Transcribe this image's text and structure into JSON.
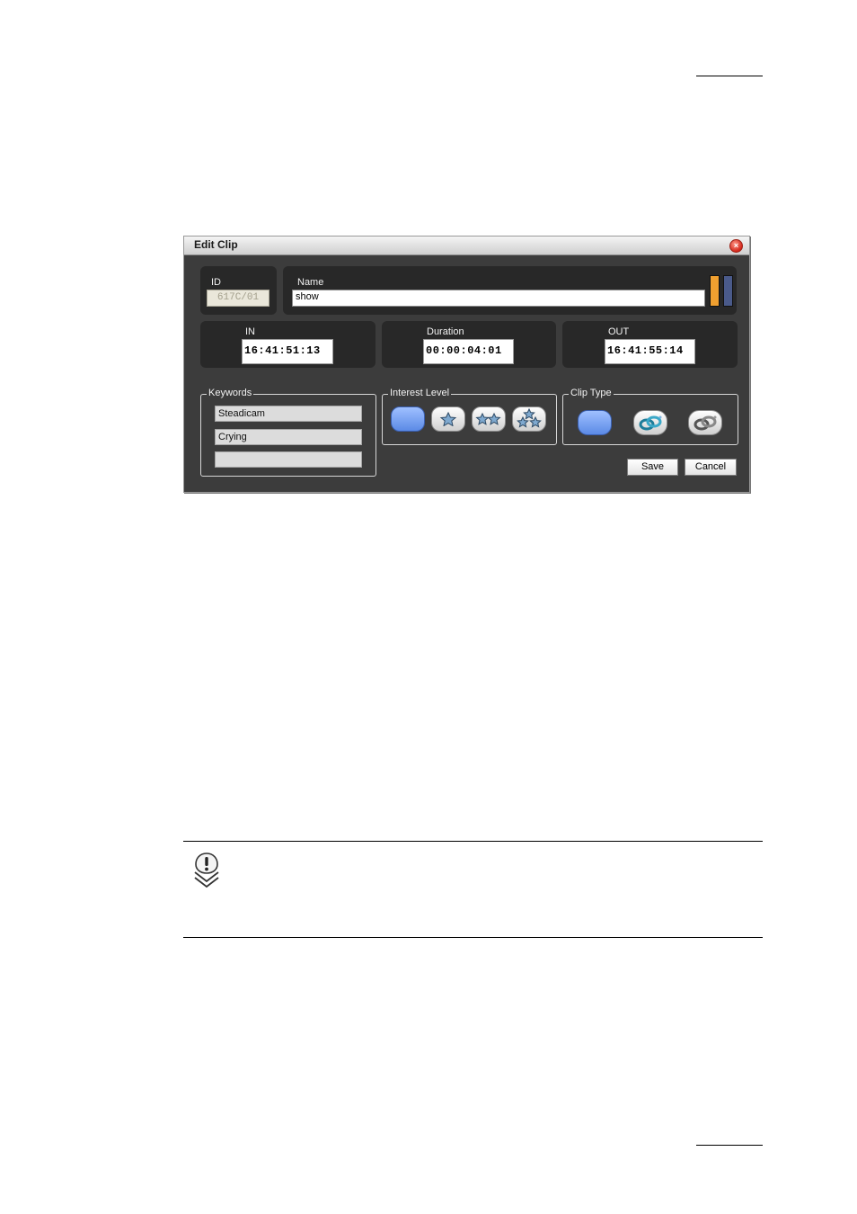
{
  "window": {
    "title": "Edit Clip",
    "close_icon": "close-icon"
  },
  "clip": {
    "id_label": "ID",
    "id_value": "617C/01",
    "name_label": "Name",
    "name_value": "show"
  },
  "colors": {
    "accent_orange": "#f0a030",
    "accent_blue": "#4a5a8a",
    "selected_blue": "#6f97f0"
  },
  "timecodes": {
    "in_label": "IN",
    "in_value": "16:41:51:13",
    "duration_label": "Duration",
    "duration_value": "00:00:04:01",
    "out_label": "OUT",
    "out_value": "16:41:55:14"
  },
  "keywords": {
    "legend": "Keywords",
    "items": [
      "Steadicam",
      "Crying",
      ""
    ]
  },
  "interest_level": {
    "legend": "Interest Level",
    "options": [
      "none",
      "one-star-icon",
      "two-stars-icon",
      "three-stars-icon"
    ],
    "selected": "none"
  },
  "clip_type": {
    "legend": "Clip Type",
    "options": [
      "none",
      "color-link-icon",
      "gray-link-icon"
    ],
    "selected": "none"
  },
  "buttons": {
    "save": "Save",
    "cancel": "Cancel"
  },
  "note_icon": "important-note-icon"
}
